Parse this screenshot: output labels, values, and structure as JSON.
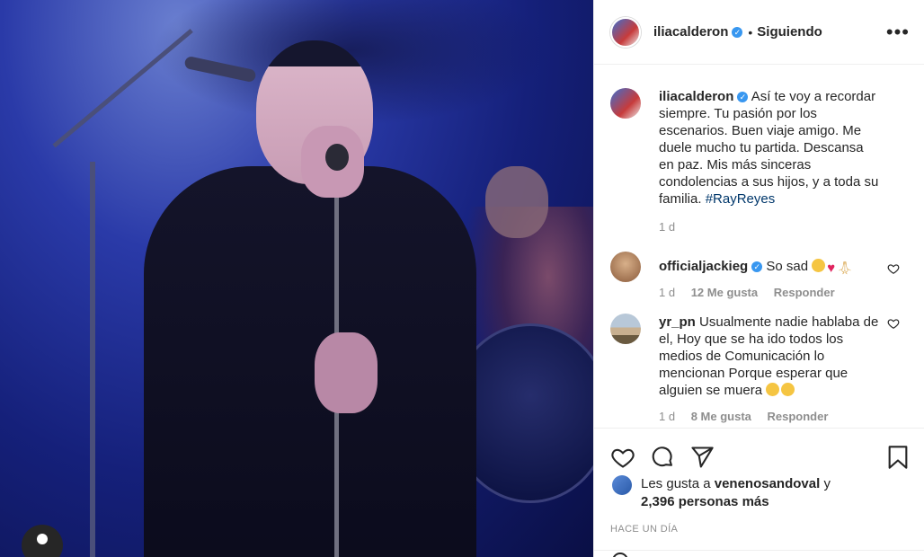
{
  "post": {
    "username": "iliacalderon",
    "follow_status": "Siguiendo",
    "separator": "•",
    "more": "•••"
  },
  "comments": [
    {
      "username": "iliacalderon",
      "text": "Así te voy a recordar siempre. Tu pasión por los escenarios. Buen viaje amigo. Me duele mucho tu partida. Descansa en paz. Mis más sinceras condolencias a sus hijos, y a toda su familia.",
      "hashtag": "#RayReyes",
      "time": "1 d"
    },
    {
      "username": "officialjackieg",
      "text": "So sad",
      "time": "1 d",
      "likes": "12 Me gusta",
      "reply": "Responder"
    },
    {
      "username": "yr_pn",
      "text": "Usualmente nadie hablaba de el, Hoy que se ha ido todos los medios de Comunicación lo mencionan Porque esperar que alguien se muera",
      "time": "1 d",
      "likes": "8 Me gusta",
      "reply": "Responder"
    }
  ],
  "likes": {
    "prefix": "Les gusta a",
    "user": "venenosandoval",
    "conj": "y",
    "count": "2,396 personas más"
  },
  "timestamp": "HACE UN DÍA",
  "colors": {
    "verified": "#3897f0",
    "hashtag": "#00376b",
    "meta": "#8e8e8e"
  }
}
